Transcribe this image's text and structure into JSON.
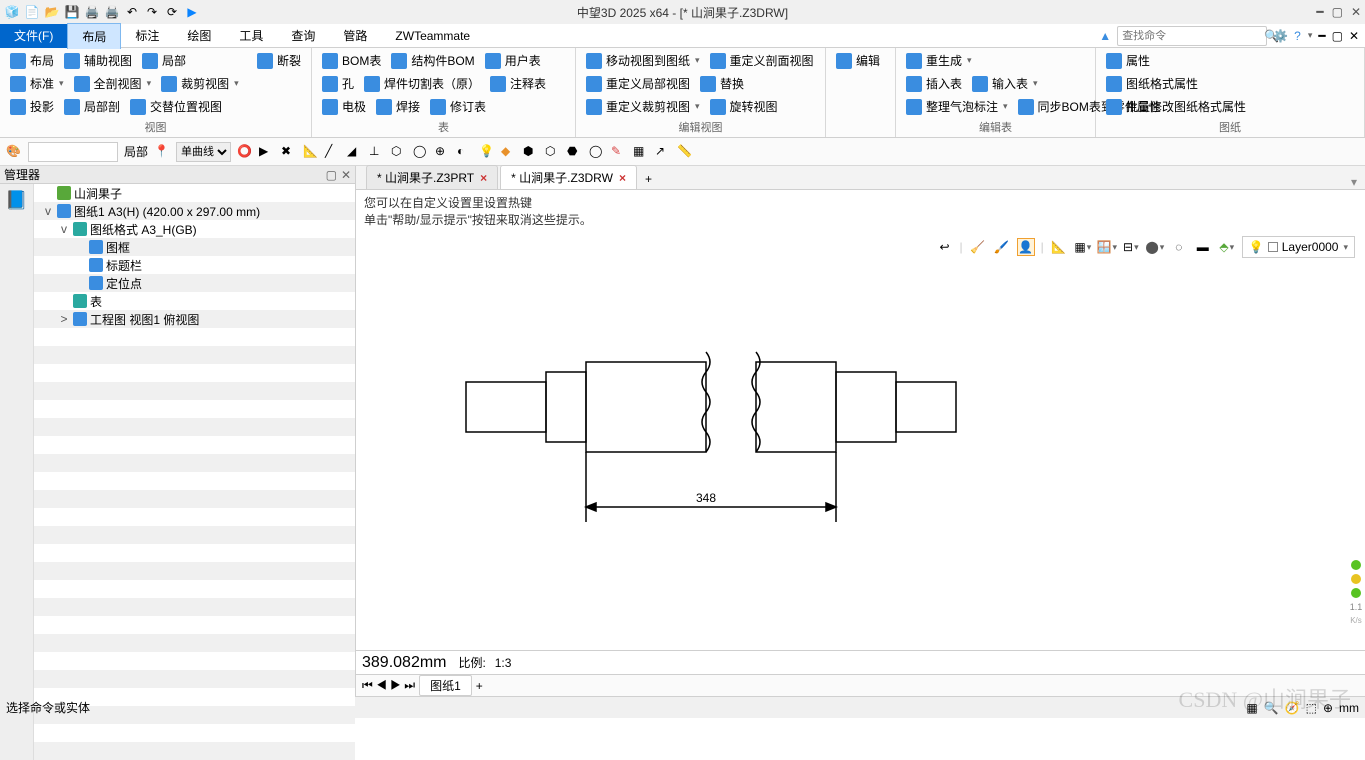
{
  "titlebar": {
    "title": "中望3D 2025 x64 - [* 山涧果子.Z3DRW]"
  },
  "menus": {
    "file": "文件(F)",
    "tabs": [
      "布局",
      "标注",
      "绘图",
      "工具",
      "查询",
      "管路",
      "ZWTeammate"
    ],
    "active_tab": "布局",
    "search_placeholder": "查找命令"
  },
  "ribbon": {
    "group_view": {
      "label": "视图",
      "items": [
        [
          "布局",
          "辅助视图",
          "局部",
          "",
          "断裂"
        ],
        [
          "标准",
          "全剖视图",
          "裁剪视图",
          "",
          ""
        ],
        [
          "投影",
          "局部剖",
          "交替位置视图",
          "",
          ""
        ]
      ]
    },
    "group_table": {
      "label": "表",
      "items": [
        [
          "BOM表",
          "结构件BOM",
          "用户表"
        ],
        [
          "孔",
          "焊件切割表（原）",
          "注释表"
        ],
        [
          "电极",
          "焊接",
          "修订表"
        ]
      ]
    },
    "group_editview": {
      "label": "编辑视图",
      "items": [
        [
          "移动视图到图纸",
          "重定义剖面视图",
          "编辑"
        ],
        [
          "重定义局部视图",
          "替换",
          ""
        ],
        [
          "重定义裁剪视图",
          "旋转视图",
          ""
        ]
      ]
    },
    "group_edittable": {
      "label": "编辑表",
      "items": [
        [
          "重生成",
          "",
          ""
        ],
        [
          "插入表",
          "输入表",
          ""
        ],
        [
          "整理气泡标注",
          "同步BOM表到零件属性",
          ""
        ]
      ]
    },
    "group_drawing": {
      "label": "图纸",
      "items": [
        [
          "属性"
        ],
        [
          "图纸格式属性"
        ],
        [
          "批量修改图纸格式属性"
        ]
      ]
    }
  },
  "toolbar2": {
    "label1": "局部",
    "curve_sel": "单曲线"
  },
  "manager": {
    "title": "管理器",
    "tree": [
      {
        "lvl": 0,
        "tw": "",
        "icon": "green",
        "text": "山涧果子"
      },
      {
        "lvl": 0,
        "tw": "v",
        "icon": "blue",
        "text": "图纸1 A3(H) (420.00 x 297.00 mm)"
      },
      {
        "lvl": 1,
        "tw": "v",
        "icon": "teal",
        "text": "图纸格式 A3_H(GB)"
      },
      {
        "lvl": 2,
        "tw": "",
        "icon": "blue",
        "text": "图框"
      },
      {
        "lvl": 2,
        "tw": "",
        "icon": "blue",
        "text": "标题栏"
      },
      {
        "lvl": 2,
        "tw": "",
        "icon": "blue",
        "text": "定位点"
      },
      {
        "lvl": 1,
        "tw": "",
        "icon": "teal",
        "text": "表"
      },
      {
        "lvl": 1,
        "tw": ">",
        "icon": "blue",
        "text": "工程图 视图1 俯视图"
      }
    ]
  },
  "doc_tabs": [
    {
      "label": "* 山涧果子.Z3PRT",
      "active": false
    },
    {
      "label": "* 山涧果子.Z3DRW",
      "active": true
    }
  ],
  "hints": [
    "您可以在自定义设置里设置热键",
    "单击\"帮助/显示提示\"按钮来取消这些提示。"
  ],
  "layer": "Layer0000",
  "dimension_value": "348",
  "viewport_status": {
    "measure": "389.082mm",
    "scale_label": "比例:",
    "scale": "1:3",
    "sheet": "图纸1"
  },
  "statusbar": {
    "msg": "选择命令或实体"
  },
  "watermark": "CSDN @山涧果子",
  "side": {
    "val": "1.1",
    "unit": "K/s"
  }
}
